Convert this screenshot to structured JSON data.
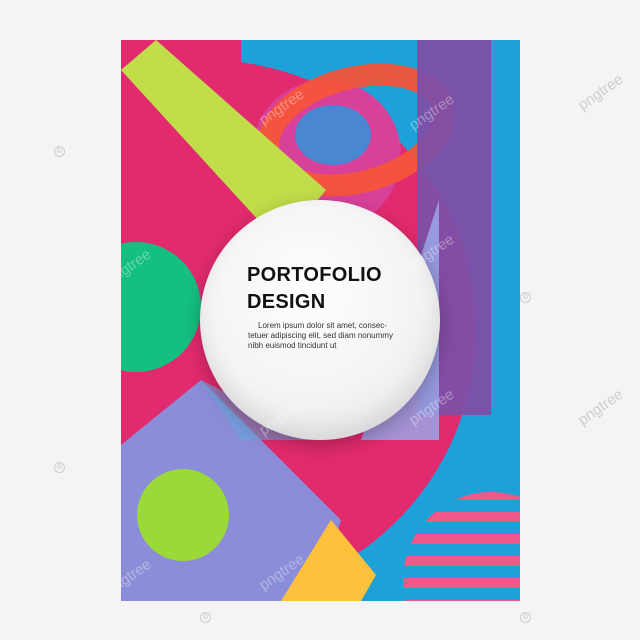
{
  "poster": {
    "title_line1": "PORTOFOLIO",
    "title_line2": "DESIGN",
    "body_line1": "Lorem ipsum dolor sit amet, consec-",
    "body_line2": "tetuer adipiscing elit, sed diam nonummy",
    "body_line3": "nibh euismod tincidunt ut"
  },
  "watermark": {
    "text": "pngtree",
    "symbol": "©"
  },
  "colors": {
    "background": "#f4f4f4",
    "poster_blue": "#1ea0d9",
    "magenta": "#e22a6f",
    "lime": "#c1dd4a",
    "orange_red": "#f4543a",
    "pink": "#d8419a",
    "purple": "#7e4fa6",
    "green": "#14c07f",
    "lavender": "#8b8dd8",
    "yellow": "#fec13c",
    "light_green": "#9bd83a",
    "stripe_pink": "#f1588a"
  }
}
